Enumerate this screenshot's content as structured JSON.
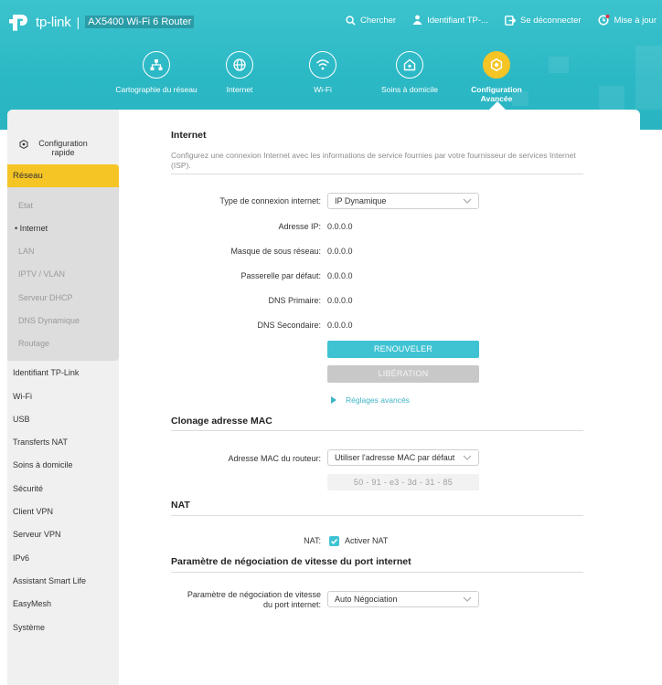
{
  "header": {
    "brand": "tp-link",
    "model": "AX5400 Wi-Fi 6 Router",
    "actions": [
      {
        "label": "Chercher",
        "icon": "search-icon"
      },
      {
        "label": "Identifiant TP-...",
        "icon": "tp-id-icon"
      },
      {
        "label": "Se déconnecter",
        "icon": "logout-icon"
      },
      {
        "label": "Mise à jour",
        "icon": "update-icon"
      }
    ],
    "nav": [
      {
        "label": "Cartographie du réseau",
        "icon": "network-map-icon"
      },
      {
        "label": "Internet",
        "icon": "globe-icon"
      },
      {
        "label": "Wi-Fi",
        "icon": "wifi-icon"
      },
      {
        "label": "Soins à domicile",
        "icon": "home-care-icon"
      },
      {
        "label": "Configuration Avancée",
        "icon": "gear-icon",
        "active": true
      }
    ],
    "colors": {
      "teal": "#2bb8c5",
      "active": "#f5c425"
    }
  },
  "sidebar": {
    "quick_setup": "Configuration rapide",
    "group": "Réseau",
    "sub_items": [
      "Etat",
      "Internet",
      "LAN",
      "IPTV / VLAN",
      "Serveur DHCP",
      "DNS Dynamique",
      "Routage"
    ],
    "active_sub": "Internet",
    "items": [
      "Identifiant TP-Link",
      "Wi-Fi",
      "USB",
      "Transferts NAT",
      "Soins à domicile",
      "Sécurité",
      "Client VPN",
      "Serveur VPN",
      "IPv6",
      "Assistant Smart Life",
      "EasyMesh",
      "Système"
    ]
  },
  "internet": {
    "title": "Internet",
    "description": "Configurez une connexion Internet avec les informations de service fournies par votre fournisseur de services Internet (ISP).",
    "fields": {
      "conn_type_label": "Type de connexion internet:",
      "conn_type_value": "IP Dynamique",
      "ip_label": "Adresse IP:",
      "ip_value": "0.0.0.0",
      "mask_label": "Masque de sous réseau:",
      "mask_value": "0.0.0.0",
      "gateway_label": "Passerelle par défaut:",
      "gateway_value": "0.0.0.0",
      "dns1_label": "DNS Primaire:",
      "dns1_value": "0.0.0.0",
      "dns2_label": "DNS Secondaire:",
      "dns2_value": "0.0.0.0"
    },
    "renew_button": "RENOUVELER",
    "release_button": "LIBÉRATION",
    "advanced_link": "Réglages avancés"
  },
  "mac_clone": {
    "title": "Clonage adresse MAC",
    "label": "Adresse MAC du routeur:",
    "select_value": "Utiliser l'adresse MAC par défaut",
    "mac_value": "50 - 91 - e3 - 3d - 31 - 85"
  },
  "nat": {
    "title": "NAT",
    "label": "NAT:",
    "checkbox_label": "Activer NAT",
    "checked": true
  },
  "port_speed": {
    "title": "Paramètre de négociation de vitesse du port internet",
    "label_line1": "Paramètre de négociation de vitesse",
    "label_line2": "du port internet:",
    "select_value": "Auto Négociation"
  }
}
